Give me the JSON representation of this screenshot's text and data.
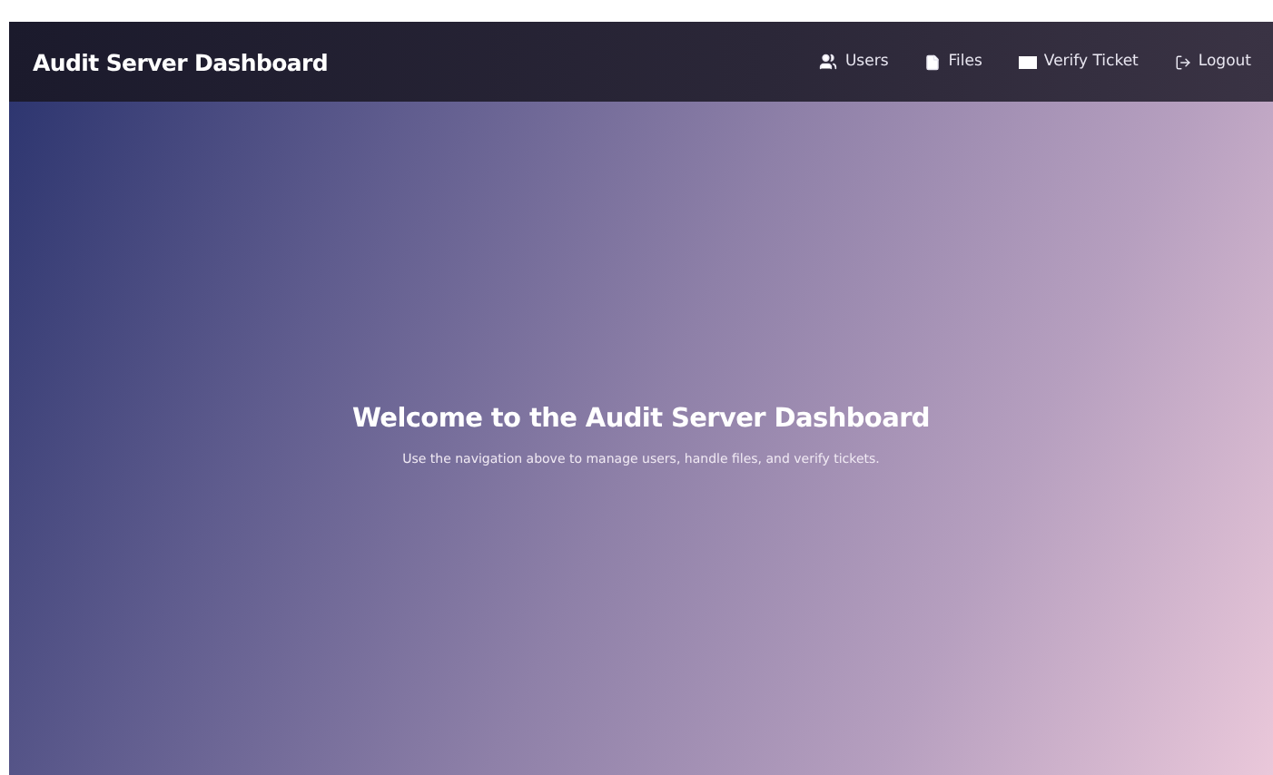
{
  "navbar": {
    "brand": "Audit Server Dashboard",
    "links": [
      {
        "label": "Users"
      },
      {
        "label": "Files"
      },
      {
        "label": "Verify Ticket"
      },
      {
        "label": "Logout"
      }
    ]
  },
  "hero": {
    "heading": "Welcome to the Audit Server Dashboard",
    "text": "Use the navigation above to manage users, handle files, and verify tickets."
  }
}
